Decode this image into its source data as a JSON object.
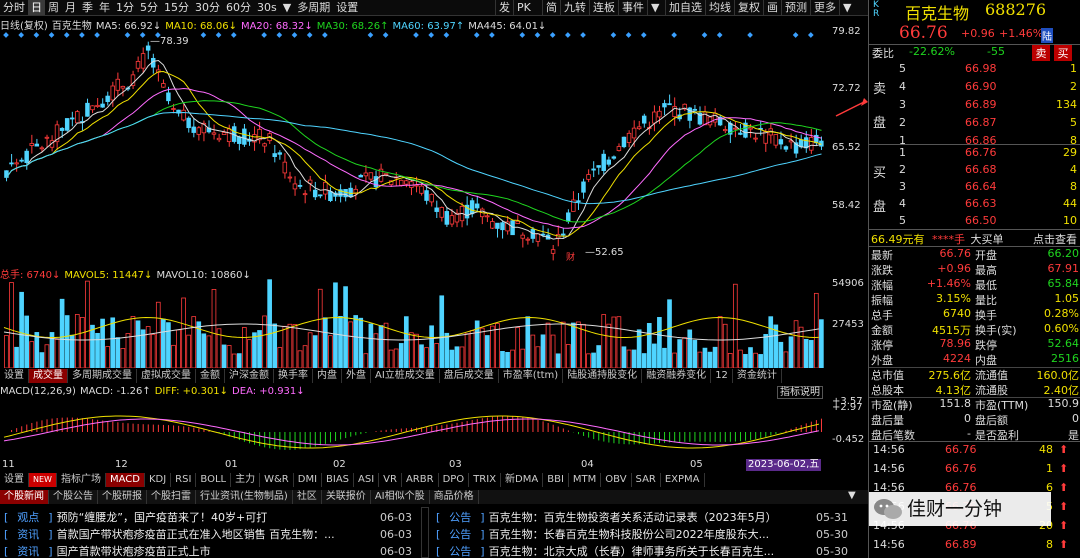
{
  "toolbar": {
    "left": [
      "分时",
      "日",
      "周",
      "月",
      "季",
      "年",
      "1分",
      "5分",
      "15分",
      "30分",
      "60分",
      "30s",
      "▼",
      "多周期",
      "设置"
    ],
    "selected": "日",
    "right": [
      "发",
      "PK",
      "简",
      "九转",
      "连板",
      "事件",
      "▼",
      "加自选",
      "均线",
      "复权",
      "画",
      "预测",
      "更多",
      "▼"
    ]
  },
  "stock": {
    "name": "百克生物",
    "code": "688276",
    "price": "66.76",
    "chg": "+0.96",
    "pct": "+1.46%",
    "tag": "陆"
  },
  "ma_legend": [
    {
      "text": "日线(复权)",
      "color": "#dddddd"
    },
    {
      "text": "百克生物",
      "color": "#dddddd"
    },
    {
      "text": "MA5: 66.92↓",
      "color": "#dddddd"
    },
    {
      "text": "MA10: 68.06↓",
      "color": "#f0e000"
    },
    {
      "text": "MA20: 68.32↓",
      "color": "#ff6bff"
    },
    {
      "text": "MA30: 68.26↑",
      "color": "#1fd51f"
    },
    {
      "text": "MA60: 63.97↑",
      "color": "#4fd4ff"
    },
    {
      "text": "MA445: 64.01↓",
      "color": "#dddddd"
    }
  ],
  "price_axis": [
    "79.82",
    "72.72",
    "65.52",
    "58.42"
  ],
  "annotations": {
    "high": "78.39",
    "low": "52.65",
    "fin": "财"
  },
  "vol_legend": [
    {
      "text": "总手: 6740↓",
      "color": "#ff3b3b"
    },
    {
      "text": "MAVOL5: 11447↓",
      "color": "#f0e000"
    },
    {
      "text": "MAVOL10: 10860↓",
      "color": "#dddddd"
    }
  ],
  "vol_axis": [
    "54906",
    "27453"
  ],
  "ind_tabs": [
    "设置",
    "成交量",
    "多周期成交量",
    "虚拟成交量",
    "金额",
    "沪深金额",
    "换手率",
    "内盘",
    "外盘",
    "AI立桩成交量",
    "盘后成交量",
    "市盈率(ttm)",
    "陆股通持股变化",
    "融资融券变化",
    "12",
    "资金统计"
  ],
  "ind_tab_selected": "成交量",
  "macd_legend": [
    {
      "text": "MACD(12,26,9)",
      "color": "#dddddd"
    },
    {
      "text": "MACD: -1.26↑",
      "color": "#dddddd"
    },
    {
      "text": "DIFF: +0.301↓",
      "color": "#f0e000"
    },
    {
      "text": "DEA: +0.931↓",
      "color": "#ff6bff"
    }
  ],
  "macd_axis": [
    "+3.57",
    "+2.97",
    "-0.452"
  ],
  "macd_note": "指标说明",
  "months": [
    "11",
    "12",
    "01",
    "02",
    "03",
    "04",
    "05"
  ],
  "date_tag": "2023-06-02,五",
  "bottom_tabs": [
    "设置",
    "NEW",
    "指标广场",
    "MACD",
    "KDJ",
    "RSI",
    "BOLL",
    "主力",
    "W&R",
    "DMI",
    "BIAS",
    "ASI",
    "VR",
    "ARBR",
    "DPO",
    "TRIX",
    "新DMA",
    "BBI",
    "MTM",
    "OBV",
    "SAR",
    "EXPMA"
  ],
  "bottom_selected": "MACD",
  "news_tabs": [
    "个股新闻",
    "个股公告",
    "个股研报",
    "个股扫雷",
    "行业资讯(生物制品)",
    "社区",
    "关联报价",
    "AI相似个股",
    "商品价格"
  ],
  "news_left": [
    {
      "tag": "观点",
      "title": "预防“缠腰龙”，国产疫苗来了！40岁+可打",
      "date": "06-03"
    },
    {
      "tag": "资讯",
      "title": "首款国产带状疱疹疫苗正式在准入地区销售 百克生物：...",
      "date": "06-03"
    },
    {
      "tag": "资讯",
      "title": "国产首款带状疱疹疫苗正式上市",
      "date": "06-03"
    }
  ],
  "news_right": [
    {
      "tag": "公告",
      "title": "百克生物：百克生物投资者关系活动记录表（2023年5月）",
      "date": "05-31"
    },
    {
      "tag": "公告",
      "title": "百克生物：长春百克生物科技股份公司2022年度股东大...",
      "date": "05-30"
    },
    {
      "tag": "公告",
      "title": "百克生物：北京大成（长春）律师事务所关于长春百克生...",
      "date": "05-30"
    }
  ],
  "order_book": {
    "weibi_label": "委比",
    "weibi_pct": "-22.62%",
    "weibi_diff": "-55",
    "btn_sell": "卖",
    "btn_buy": "买",
    "asks": [
      {
        "n": "5",
        "p": "66.98",
        "v": "1"
      },
      {
        "n": "4",
        "p": "66.90",
        "v": "2"
      },
      {
        "n": "3",
        "p": "66.89",
        "v": "134"
      },
      {
        "n": "2",
        "p": "66.87",
        "v": "5"
      },
      {
        "n": "1",
        "p": "66.86",
        "v": "8"
      }
    ],
    "bids": [
      {
        "n": "1",
        "p": "66.76",
        "v": "29"
      },
      {
        "n": "2",
        "p": "66.68",
        "v": "4"
      },
      {
        "n": "3",
        "p": "66.64",
        "v": "8"
      },
      {
        "n": "4",
        "p": "66.63",
        "v": "44"
      },
      {
        "n": "5",
        "p": "66.50",
        "v": "10"
      }
    ],
    "ask_label": [
      "卖",
      "盘"
    ],
    "bid_label": [
      "买",
      "盘"
    ]
  },
  "big_order": {
    "price": "66.49元有",
    "qty": "****手",
    "label": "大买单",
    "action": "点击查看"
  },
  "quote": [
    [
      {
        "k": "最新",
        "v": "66.76",
        "c": "red"
      },
      {
        "k": "开盘",
        "v": "66.20",
        "c": "grn"
      }
    ],
    [
      {
        "k": "涨跌",
        "v": "+0.96",
        "c": "red"
      },
      {
        "k": "最高",
        "v": "67.91",
        "c": "red"
      }
    ],
    [
      {
        "k": "涨幅",
        "v": "+1.46%",
        "c": "red"
      },
      {
        "k": "最低",
        "v": "65.84",
        "c": "grn"
      }
    ],
    [
      {
        "k": "振幅",
        "v": "3.15%",
        "c": "yel"
      },
      {
        "k": "量比",
        "v": "1.05",
        "c": "yel"
      }
    ],
    [
      {
        "k": "总手",
        "v": "6740",
        "c": "yel"
      },
      {
        "k": "换手",
        "v": "0.28%",
        "c": "yel"
      }
    ],
    [
      {
        "k": "金额",
        "v": "4515万",
        "c": "yel"
      },
      {
        "k": "换手(实)",
        "v": "0.60%",
        "c": "yel"
      }
    ],
    [
      {
        "k": "涨停",
        "v": "78.96",
        "c": "red"
      },
      {
        "k": "跌停",
        "v": "52.64",
        "c": "grn"
      }
    ],
    [
      {
        "k": "外盘",
        "v": "4224",
        "c": "red"
      },
      {
        "k": "内盘",
        "v": "2516",
        "c": "grn"
      }
    ],
    [
      {
        "k": "总市值",
        "v": "275.6亿",
        "c": "yel"
      },
      {
        "k": "流通值",
        "v": "160.0亿",
        "c": "yel"
      }
    ],
    [
      {
        "k": "总股本",
        "v": "4.13亿",
        "c": "yel"
      },
      {
        "k": "流通股",
        "v": "2.40亿",
        "c": "yel"
      }
    ],
    [
      {
        "k": "市盈(静)",
        "v": "151.8",
        "c": "wht"
      },
      {
        "k": "市盈(TTM)",
        "v": "150.9",
        "c": "wht"
      }
    ],
    [
      {
        "k": "盘后量",
        "v": "0",
        "c": "wht"
      },
      {
        "k": "盘后额",
        "v": "0",
        "c": "wht"
      }
    ],
    [
      {
        "k": "盘后笔数",
        "v": "-",
        "c": "wht"
      },
      {
        "k": "是否盈利",
        "v": "是",
        "c": "wht"
      }
    ]
  ],
  "ticks": [
    {
      "t": "14:56",
      "p": "66.76",
      "v": "48",
      "c": "red"
    },
    {
      "t": "14:56",
      "p": "66.76",
      "v": "1",
      "c": "red"
    },
    {
      "t": "14:56",
      "p": "66.76",
      "v": "6",
      "c": "red"
    },
    {
      "t": "14:56",
      "p": "66.76",
      "v": "5",
      "c": "red"
    },
    {
      "t": "14:56",
      "p": "66.76",
      "v": "20",
      "c": "red"
    },
    {
      "t": "14:56",
      "p": "66.89",
      "v": "8",
      "c": "red"
    }
  ],
  "watermark": "佳财一分钟",
  "side_letters": [
    "K",
    "R"
  ]
}
